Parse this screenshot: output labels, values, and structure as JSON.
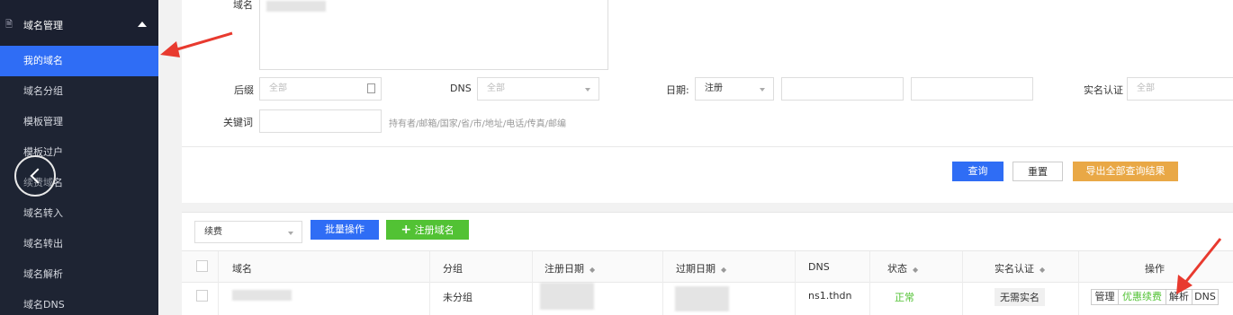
{
  "sidebar": {
    "header": "域名管理",
    "items": [
      "我的域名",
      "域名分组",
      "模板管理",
      "模板过户",
      "续费域名",
      "域名转入",
      "域名转出",
      "域名解析",
      "域名DNS"
    ]
  },
  "filters": {
    "domain_label": "域名",
    "suffix_label": "后缀",
    "suffix_placeholder": "全部",
    "dns_label": "DNS",
    "dns_placeholder": "全部",
    "date_label": "日期:",
    "date_type": "注册",
    "realname_label": "实名认证",
    "realname_placeholder": "全部",
    "keyword_label": "关键词",
    "keyword_hint": "持有者/邮箱/国家/省/市/地址/电话/传真/邮编"
  },
  "actions": {
    "query": "查询",
    "reset": "重置",
    "export": "导出全部查询结果"
  },
  "toolbar": {
    "renew_select": "续费",
    "batch": "批量操作",
    "register_icon": "plus-icon",
    "register": "注册域名"
  },
  "table": {
    "headers": [
      "域名",
      "分组",
      "注册日期",
      "过期日期",
      "DNS",
      "状态",
      "实名认证",
      "操作"
    ],
    "rows": [
      {
        "group": "未分组",
        "dns": "ns1.thdn",
        "status": "正常",
        "realname": "无需实名",
        "ops": [
          "管理",
          "优惠续费",
          "解析",
          "DNS"
        ]
      }
    ]
  },
  "colors": {
    "sidebar_bg": "#1e2433",
    "active": "#2f6df5",
    "primary": "#2f6df5",
    "success": "#52c234",
    "warning": "#e9a846",
    "annotation": "#e83a2f"
  }
}
